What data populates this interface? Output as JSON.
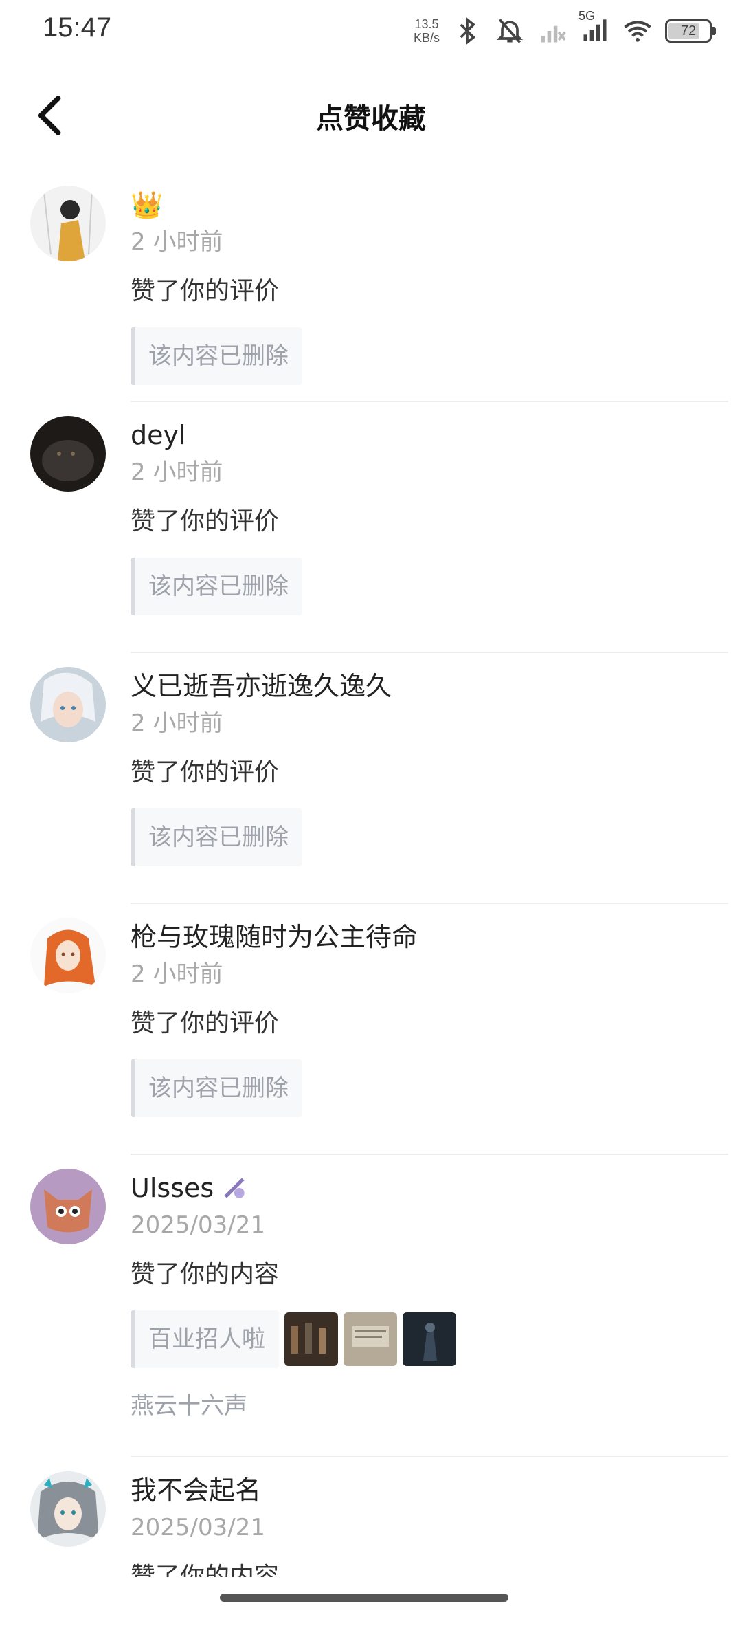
{
  "status_bar": {
    "time": "15:47",
    "net_speed_value": "13.5",
    "net_speed_unit": "KB/s",
    "network_type": "5G",
    "battery": "72"
  },
  "header": {
    "title": "点赞收藏"
  },
  "items": [
    {
      "username": "👑",
      "time": "2 小时前",
      "action": "赞了你的评价",
      "ref_text": "该内容已删除"
    },
    {
      "username": "deyl",
      "time": "2 小时前",
      "action": "赞了你的评价",
      "ref_text": "该内容已删除"
    },
    {
      "username": "义已逝吾亦逝逸久逸久",
      "time": "2 小时前",
      "action": "赞了你的评价",
      "ref_text": "该内容已删除"
    },
    {
      "username": "枪与玫瑰随时为公主待命",
      "time": "2 小时前",
      "action": "赞了你的评价",
      "ref_text": "该内容已删除"
    },
    {
      "username": "Ulsses",
      "time": "2025/03/21",
      "action": "赞了你的内容",
      "ref_text": "百业招人啦",
      "source": "燕云十六声"
    },
    {
      "username": "我不会起名",
      "time": "2025/03/21",
      "action": "赞了你的内容"
    }
  ],
  "colors": {
    "background": "#ffffff",
    "muted_text": "#a8a8a8",
    "ref_bg": "#f7f8fa"
  }
}
